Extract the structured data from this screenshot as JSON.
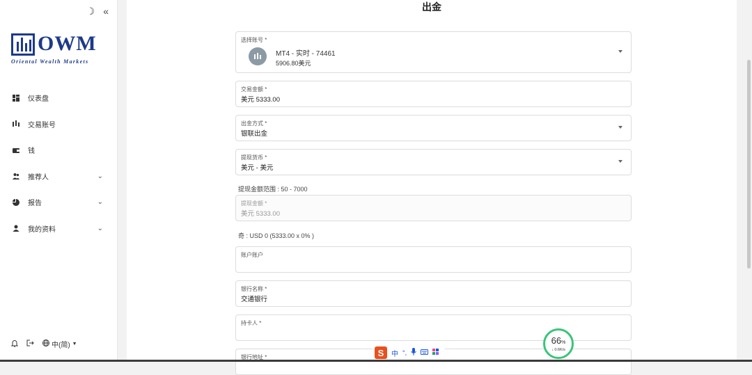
{
  "sidebar": {
    "logo_text": "OWM",
    "logo_sub": "Oriental Wealth Markets",
    "items": [
      {
        "label": "仪表盘",
        "icon": "dashboard-icon",
        "has_chevron": false
      },
      {
        "label": "交易账号",
        "icon": "candlestick-icon",
        "has_chevron": false
      },
      {
        "label": "钱",
        "icon": "wallet-icon",
        "has_chevron": false
      },
      {
        "label": "推荐人",
        "icon": "users-icon",
        "has_chevron": true
      },
      {
        "label": "报告",
        "icon": "pie-chart-icon",
        "has_chevron": true
      },
      {
        "label": "我的资料",
        "icon": "user-icon",
        "has_chevron": true
      }
    ],
    "language": "中(简)",
    "chevron": "⌄"
  },
  "page": {
    "title": "出金"
  },
  "form": {
    "account": {
      "label": "选择账号 *",
      "line1": "MT4 - 实时 - 74461",
      "line2": "5906.80美元"
    },
    "amount": {
      "label": "交易金额 *",
      "value": "美元 5333.00"
    },
    "method": {
      "label": "出金方式 *",
      "value": "银联出金"
    },
    "currency": {
      "label": "提现货币 *",
      "value": "美元 - 美元"
    },
    "range_text": "提现金额范围 : 50 - 7000",
    "withdraw_amount": {
      "label": "提现金额 *",
      "value": "美元 5333.00"
    },
    "fee_text": "奇 : USD 0 (5333.00 x 0% )",
    "account_no": {
      "label": "账户账户"
    },
    "bank_name": {
      "label": "银行名称 *",
      "value": "交通银行"
    },
    "holder": {
      "label": "持卡人 *"
    },
    "bank_addr": {
      "label": "银行地址 *"
    }
  },
  "overlay": {
    "ime_logo": "S",
    "ime_lang": "中",
    "speed_pct": "66",
    "speed_unit": "%",
    "speed_rate": "↓ 0.6K/s"
  }
}
